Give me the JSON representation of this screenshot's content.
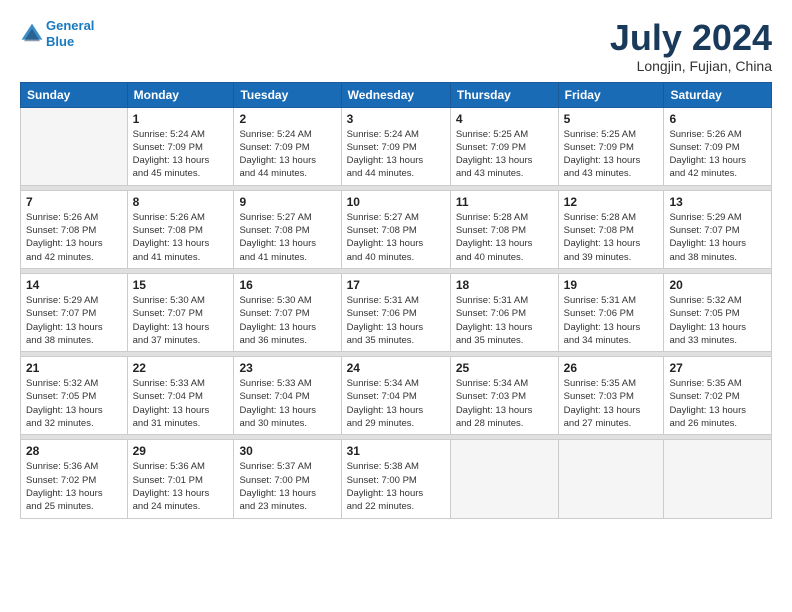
{
  "logo": {
    "line1": "General",
    "line2": "Blue"
  },
  "title": "July 2024",
  "location": "Longjin, Fujian, China",
  "weekdays": [
    "Sunday",
    "Monday",
    "Tuesday",
    "Wednesday",
    "Thursday",
    "Friday",
    "Saturday"
  ],
  "weeks": [
    [
      {
        "day": "",
        "empty": true
      },
      {
        "day": "1",
        "sunrise": "5:24 AM",
        "sunset": "7:09 PM",
        "daylight": "13 hours and 45 minutes."
      },
      {
        "day": "2",
        "sunrise": "5:24 AM",
        "sunset": "7:09 PM",
        "daylight": "13 hours and 44 minutes."
      },
      {
        "day": "3",
        "sunrise": "5:24 AM",
        "sunset": "7:09 PM",
        "daylight": "13 hours and 44 minutes."
      },
      {
        "day": "4",
        "sunrise": "5:25 AM",
        "sunset": "7:09 PM",
        "daylight": "13 hours and 43 minutes."
      },
      {
        "day": "5",
        "sunrise": "5:25 AM",
        "sunset": "7:09 PM",
        "daylight": "13 hours and 43 minutes."
      },
      {
        "day": "6",
        "sunrise": "5:26 AM",
        "sunset": "7:09 PM",
        "daylight": "13 hours and 42 minutes."
      }
    ],
    [
      {
        "day": "7",
        "sunrise": "5:26 AM",
        "sunset": "7:08 PM",
        "daylight": "13 hours and 42 minutes."
      },
      {
        "day": "8",
        "sunrise": "5:26 AM",
        "sunset": "7:08 PM",
        "daylight": "13 hours and 41 minutes."
      },
      {
        "day": "9",
        "sunrise": "5:27 AM",
        "sunset": "7:08 PM",
        "daylight": "13 hours and 41 minutes."
      },
      {
        "day": "10",
        "sunrise": "5:27 AM",
        "sunset": "7:08 PM",
        "daylight": "13 hours and 40 minutes."
      },
      {
        "day": "11",
        "sunrise": "5:28 AM",
        "sunset": "7:08 PM",
        "daylight": "13 hours and 40 minutes."
      },
      {
        "day": "12",
        "sunrise": "5:28 AM",
        "sunset": "7:08 PM",
        "daylight": "13 hours and 39 minutes."
      },
      {
        "day": "13",
        "sunrise": "5:29 AM",
        "sunset": "7:07 PM",
        "daylight": "13 hours and 38 minutes."
      }
    ],
    [
      {
        "day": "14",
        "sunrise": "5:29 AM",
        "sunset": "7:07 PM",
        "daylight": "13 hours and 38 minutes."
      },
      {
        "day": "15",
        "sunrise": "5:30 AM",
        "sunset": "7:07 PM",
        "daylight": "13 hours and 37 minutes."
      },
      {
        "day": "16",
        "sunrise": "5:30 AM",
        "sunset": "7:07 PM",
        "daylight": "13 hours and 36 minutes."
      },
      {
        "day": "17",
        "sunrise": "5:31 AM",
        "sunset": "7:06 PM",
        "daylight": "13 hours and 35 minutes."
      },
      {
        "day": "18",
        "sunrise": "5:31 AM",
        "sunset": "7:06 PM",
        "daylight": "13 hours and 35 minutes."
      },
      {
        "day": "19",
        "sunrise": "5:31 AM",
        "sunset": "7:06 PM",
        "daylight": "13 hours and 34 minutes."
      },
      {
        "day": "20",
        "sunrise": "5:32 AM",
        "sunset": "7:05 PM",
        "daylight": "13 hours and 33 minutes."
      }
    ],
    [
      {
        "day": "21",
        "sunrise": "5:32 AM",
        "sunset": "7:05 PM",
        "daylight": "13 hours and 32 minutes."
      },
      {
        "day": "22",
        "sunrise": "5:33 AM",
        "sunset": "7:04 PM",
        "daylight": "13 hours and 31 minutes."
      },
      {
        "day": "23",
        "sunrise": "5:33 AM",
        "sunset": "7:04 PM",
        "daylight": "13 hours and 30 minutes."
      },
      {
        "day": "24",
        "sunrise": "5:34 AM",
        "sunset": "7:04 PM",
        "daylight": "13 hours and 29 minutes."
      },
      {
        "day": "25",
        "sunrise": "5:34 AM",
        "sunset": "7:03 PM",
        "daylight": "13 hours and 28 minutes."
      },
      {
        "day": "26",
        "sunrise": "5:35 AM",
        "sunset": "7:03 PM",
        "daylight": "13 hours and 27 minutes."
      },
      {
        "day": "27",
        "sunrise": "5:35 AM",
        "sunset": "7:02 PM",
        "daylight": "13 hours and 26 minutes."
      }
    ],
    [
      {
        "day": "28",
        "sunrise": "5:36 AM",
        "sunset": "7:02 PM",
        "daylight": "13 hours and 25 minutes."
      },
      {
        "day": "29",
        "sunrise": "5:36 AM",
        "sunset": "7:01 PM",
        "daylight": "13 hours and 24 minutes."
      },
      {
        "day": "30",
        "sunrise": "5:37 AM",
        "sunset": "7:00 PM",
        "daylight": "13 hours and 23 minutes."
      },
      {
        "day": "31",
        "sunrise": "5:38 AM",
        "sunset": "7:00 PM",
        "daylight": "13 hours and 22 minutes."
      },
      {
        "day": "",
        "empty": true
      },
      {
        "day": "",
        "empty": true
      },
      {
        "day": "",
        "empty": true
      }
    ]
  ],
  "labels": {
    "sunrise": "Sunrise:",
    "sunset": "Sunset:",
    "daylight": "Daylight:"
  }
}
